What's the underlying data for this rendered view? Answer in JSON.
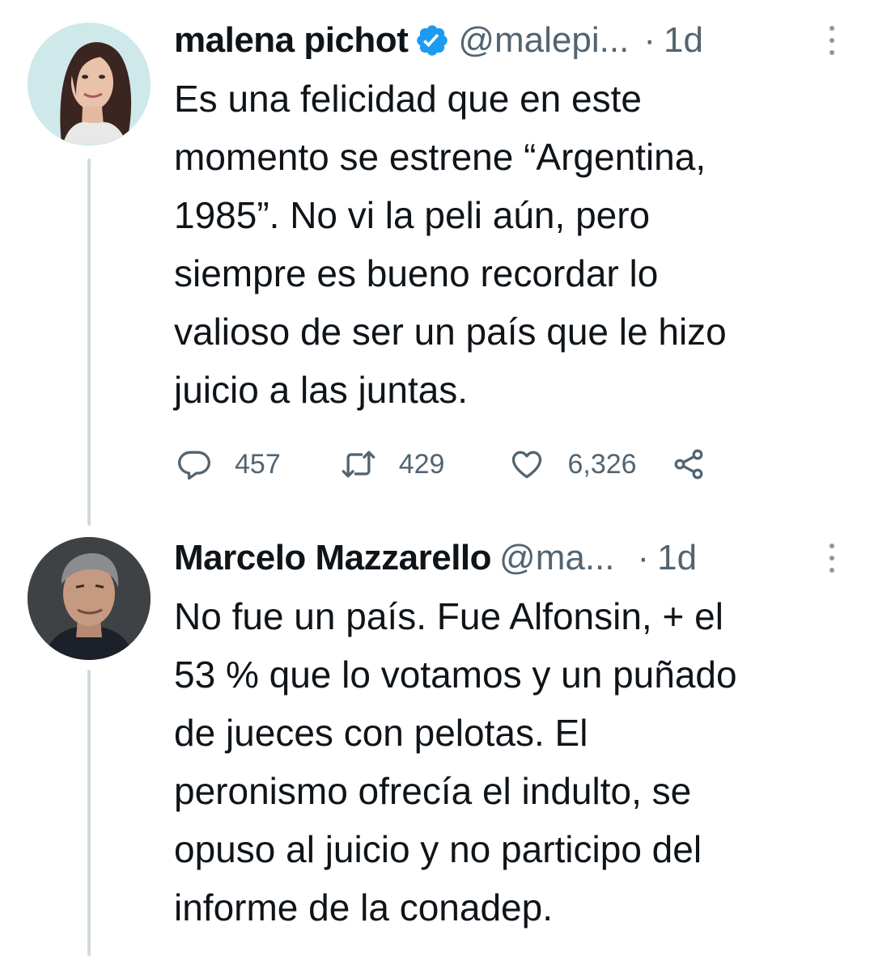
{
  "tweets": [
    {
      "name": "malena pichot",
      "verified": true,
      "handle": "@malepi...",
      "separator": "·",
      "time": "1d",
      "text": "Es una felicidad que en este\nmomento se estrene “Argentina,\n1985”. No vi la peli aún, pero\nsiempre es bueno recordar lo\nvalioso de ser un país que le hizo\njuicio a las juntas.",
      "replies": "457",
      "retweets": "429",
      "likes": "6,326",
      "avatar_bg": "#cfe9ea"
    },
    {
      "name": "Marcelo Mazzarello",
      "verified": false,
      "handle": "@ma...",
      "separator": "·",
      "time": "1d",
      "text": "No fue un país. Fue Alfonsin, + el\n53 % que lo votamos  y un puñado\nde jueces con pelotas. El\nperonismo ofrecía el indulto, se\nopuso al juicio  y no participo del\ninforme de la conadep.",
      "avatar_bg": "#3e4245"
    }
  ],
  "colors": {
    "text": "#0f1419",
    "secondary": "#536471",
    "verified_blue": "#1d9bf0",
    "thread_line": "#cfd9de"
  },
  "icons": [
    "reply-icon",
    "retweet-icon",
    "like-icon",
    "share-icon",
    "verified-badge-icon",
    "more-icon"
  ]
}
